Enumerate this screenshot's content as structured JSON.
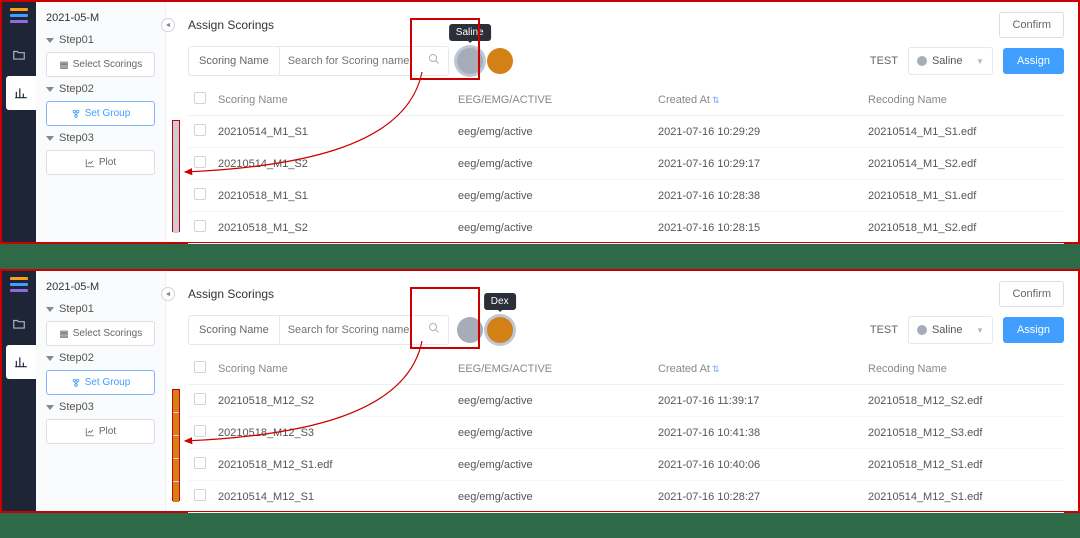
{
  "panels": [
    {
      "project_title": "2021-05-M",
      "steps": {
        "s1": "Step01",
        "s2": "Step02",
        "s3": "Step03"
      },
      "buttons": {
        "select_scorings": "Select Scorings",
        "set_group": "Set Group",
        "plot": "Plot"
      },
      "page_title": "Assign Scorings",
      "confirm_btn": "Confirm",
      "search": {
        "label": "Scoring Name",
        "placeholder": "Search for Scoring name"
      },
      "tooltip": "Saline",
      "circle_colors": {
        "grey": "#a7adb8",
        "orange": "#d38116"
      },
      "selected_circle": "grey",
      "test_label": "TEST",
      "group_select": "Saline",
      "assign_btn": "Assign",
      "columns": {
        "name": "Scoring Name",
        "eeg": "EEG/EMG/ACTIVE",
        "date": "Created At",
        "rec": "Recoding Name"
      },
      "rows": [
        {
          "name": "20210514_M1_S1",
          "eeg": "eeg/emg/active",
          "date": "2021-07-16 10:29:29",
          "rec": "20210514_M1_S1.edf"
        },
        {
          "name": "20210514_M1_S2",
          "eeg": "eeg/emg/active",
          "date": "2021-07-16 10:29:17",
          "rec": "20210514_M1_S2.edf"
        },
        {
          "name": "20210518_M1_S1",
          "eeg": "eeg/emg/active",
          "date": "2021-07-16 10:28:38",
          "rec": "20210518_M1_S1.edf"
        },
        {
          "name": "20210518_M1_S2",
          "eeg": "eeg/emg/active",
          "date": "2021-07-16 10:28:15",
          "rec": "20210518_M1_S2.edf"
        }
      ],
      "marker_style": "grey"
    },
    {
      "project_title": "2021-05-M",
      "steps": {
        "s1": "Step01",
        "s2": "Step02",
        "s3": "Step03"
      },
      "buttons": {
        "select_scorings": "Select Scorings",
        "set_group": "Set Group",
        "plot": "Plot"
      },
      "page_title": "Assign Scorings",
      "confirm_btn": "Confirm",
      "search": {
        "label": "Scoring Name",
        "placeholder": "Search for Scoring name"
      },
      "tooltip": "Dex",
      "circle_colors": {
        "grey": "#a7adb8",
        "orange": "#d38116"
      },
      "selected_circle": "orange",
      "test_label": "TEST",
      "group_select": "Saline",
      "assign_btn": "Assign",
      "columns": {
        "name": "Scoring Name",
        "eeg": "EEG/EMG/ACTIVE",
        "date": "Created At",
        "rec": "Recoding Name"
      },
      "rows": [
        {
          "name": "20210518_M12_S2",
          "eeg": "eeg/emg/active",
          "date": "2021-07-16 11:39:17",
          "rec": "20210518_M12_S2.edf"
        },
        {
          "name": "20210518_M12_S3",
          "eeg": "eeg/emg/active",
          "date": "2021-07-16 10:41:38",
          "rec": "20210518_M12_S3.edf"
        },
        {
          "name": "20210518_M12_S1.edf",
          "eeg": "eeg/emg/active",
          "date": "2021-07-16 10:40:06",
          "rec": "20210518_M12_S1.edf"
        },
        {
          "name": "20210514_M12_S1",
          "eeg": "eeg/emg/active",
          "date": "2021-07-16 10:28:27",
          "rec": "20210514_M12_S1.edf"
        }
      ],
      "marker_style": "orange"
    }
  ]
}
